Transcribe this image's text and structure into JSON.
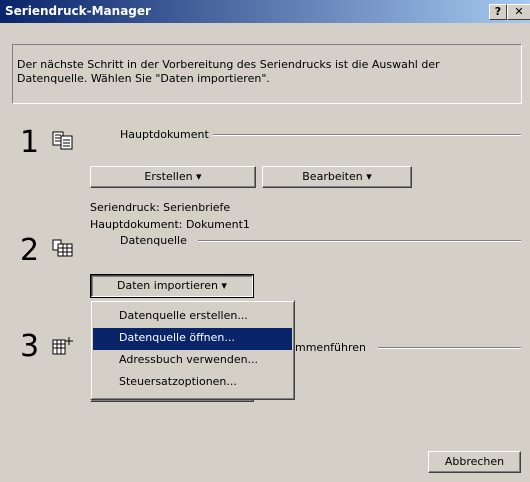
{
  "window": {
    "title": "Seriendruck-Manager",
    "help_label": "?",
    "close_label": "✕"
  },
  "info": {
    "text": "Der nächste Schritt in der Vorbereitung des Seriendrucks ist die Auswahl der Datenquelle. Wählen Sie \"Daten importieren\"."
  },
  "step1": {
    "number": "1",
    "label": "Hauptdokument",
    "icon": "main-document-icon",
    "create_button": "Erstellen ▾",
    "edit_button": "Bearbeiten ▾",
    "status_type": "Seriendruck: Serienbriefe",
    "status_doc": "Hauptdokument: Dokument1"
  },
  "step2": {
    "number": "2",
    "label": "Datenquelle",
    "icon": "data-source-icon",
    "import_button": "Daten importieren ▾"
  },
  "step3": {
    "number": "3",
    "label_visible": "mmenführen",
    "icon": "merge-icon"
  },
  "menu": {
    "items": [
      {
        "label": "Datenquelle erstellen...",
        "highlighted": false
      },
      {
        "label": "Datenquelle öffnen...",
        "highlighted": true
      },
      {
        "label": "Adressbuch verwenden...",
        "highlighted": false
      },
      {
        "label": "Steuersatzoptionen...",
        "highlighted": false
      }
    ]
  },
  "footer": {
    "cancel_button": "Abbrechen"
  },
  "colors": {
    "face": "#d4d0c8",
    "titlebar_start": "#0a246a",
    "titlebar_end": "#a6caf0",
    "highlight": "#0a246a"
  }
}
